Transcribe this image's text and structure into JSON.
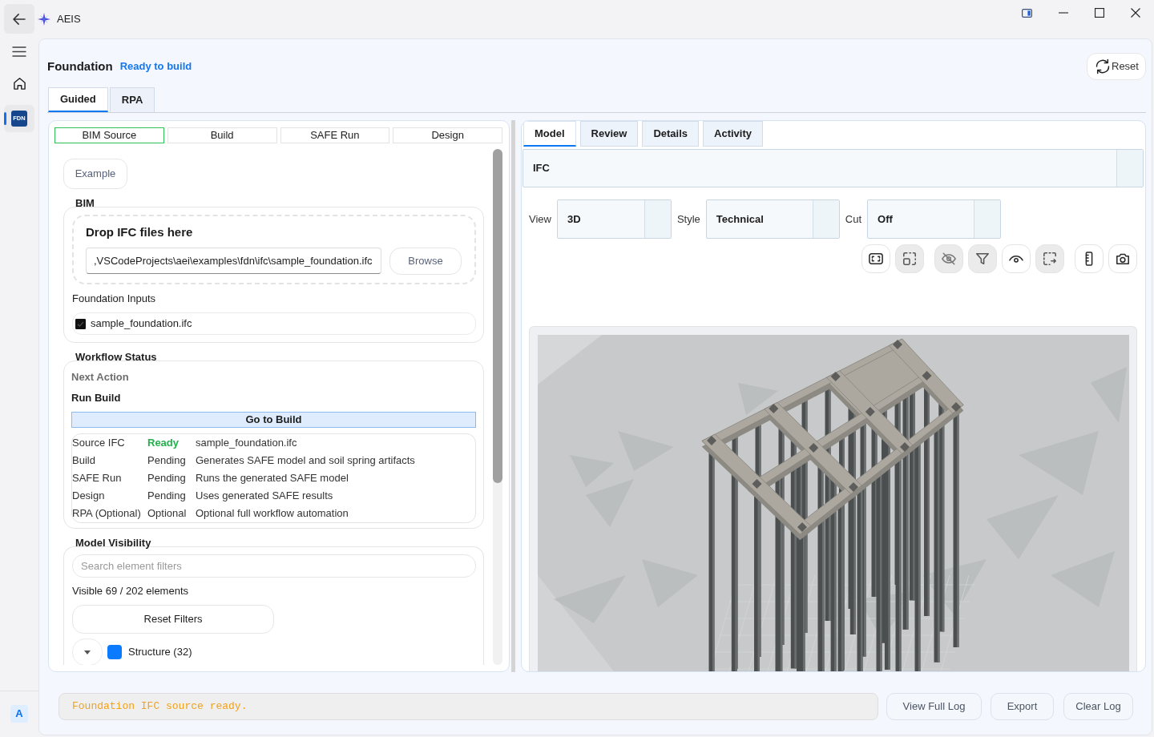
{
  "window": {
    "title": "AEIS"
  },
  "nav_rail": {
    "items": [
      {
        "kind": "home",
        "selected": false
      },
      {
        "kind": "module",
        "label": "FDN",
        "selected": true
      }
    ],
    "account": {
      "initial": "A"
    }
  },
  "header": {
    "title": "Foundation",
    "status": "Ready to build",
    "reset_button": "Reset"
  },
  "mode_tabs": [
    {
      "label": "Guided",
      "selected": true
    },
    {
      "label": "RPA",
      "selected": false
    }
  ],
  "guided_panel": {
    "steps": [
      {
        "label": "BIM Source",
        "selected": true
      },
      {
        "label": "Build",
        "selected": false
      },
      {
        "label": "SAFE Run",
        "selected": false
      },
      {
        "label": "Design",
        "selected": false
      }
    ],
    "example_button": "Example",
    "bim": {
      "title": "BIM",
      "drop_zone": {
        "title": "Drop IFC files here",
        "path": ",VSCodeProjects\\aei\\examples\\fdn\\ifc\\sample_foundation.ifc",
        "browse_button": "Browse"
      },
      "inputs_label": "Foundation Inputs",
      "inputs": [
        {
          "name": "sample_foundation.ifc",
          "checked": true
        }
      ]
    },
    "workflow_status": {
      "title": "Workflow Status",
      "next_action_label": "Next Action",
      "next_action": "Run Build",
      "action_button": "Go to Build",
      "rows": [
        {
          "stage": "Source IFC",
          "status": "Ready",
          "color": "#22b14c",
          "highlighted": true,
          "detail": "sample_foundation.ifc"
        },
        {
          "stage": "Build",
          "status": "Pending",
          "color": "#333333",
          "highlighted": false,
          "detail": "Generates SAFE model and soil spring artifacts"
        },
        {
          "stage": "SAFE Run",
          "status": "Pending",
          "color": "#333333",
          "highlighted": false,
          "detail": "Runs the generated SAFE model"
        },
        {
          "stage": "Design",
          "status": "Pending",
          "color": "#333333",
          "highlighted": false,
          "detail": "Uses generated SAFE results"
        },
        {
          "stage": "RPA (Optional)",
          "status": "Optional",
          "color": "#333333",
          "highlighted": false,
          "detail": "Optional full workflow automation"
        }
      ]
    },
    "model_visibility": {
      "title": "Model Visibility",
      "search": {
        "placeholder": "Search element filters"
      },
      "summary": "Visible 69 / 202 elements",
      "reset_button": "Reset Filters",
      "groups": [
        {
          "label": "Structure (32)",
          "expanded": true,
          "color": "#0a7aff"
        }
      ]
    }
  },
  "viewer": {
    "tabs": [
      {
        "label": "Model",
        "selected": true
      },
      {
        "label": "Review",
        "selected": false
      },
      {
        "label": "Details",
        "selected": false
      },
      {
        "label": "Activity",
        "selected": false
      }
    ],
    "source_select": {
      "value": "IFC"
    },
    "selects": [
      {
        "label": "View",
        "value": "3D"
      },
      {
        "label": "Style",
        "value": "Technical"
      },
      {
        "label": "Cut",
        "value": "Off"
      }
    ],
    "tool_groups": [
      [
        {
          "kind": "fit",
          "active": false
        },
        {
          "kind": "frame",
          "active": true
        }
      ],
      [
        {
          "kind": "hide",
          "active": true
        },
        {
          "kind": "filter",
          "active": true
        },
        {
          "kind": "show",
          "active": false
        },
        {
          "kind": "box-select",
          "active": true
        }
      ],
      [
        {
          "kind": "measure",
          "active": false
        },
        {
          "kind": "snapshot",
          "active": false
        }
      ]
    ]
  },
  "log": {
    "message": "Foundation IFC source ready.",
    "buttons": [
      "View Full Log",
      "Export",
      "Clear Log"
    ]
  }
}
